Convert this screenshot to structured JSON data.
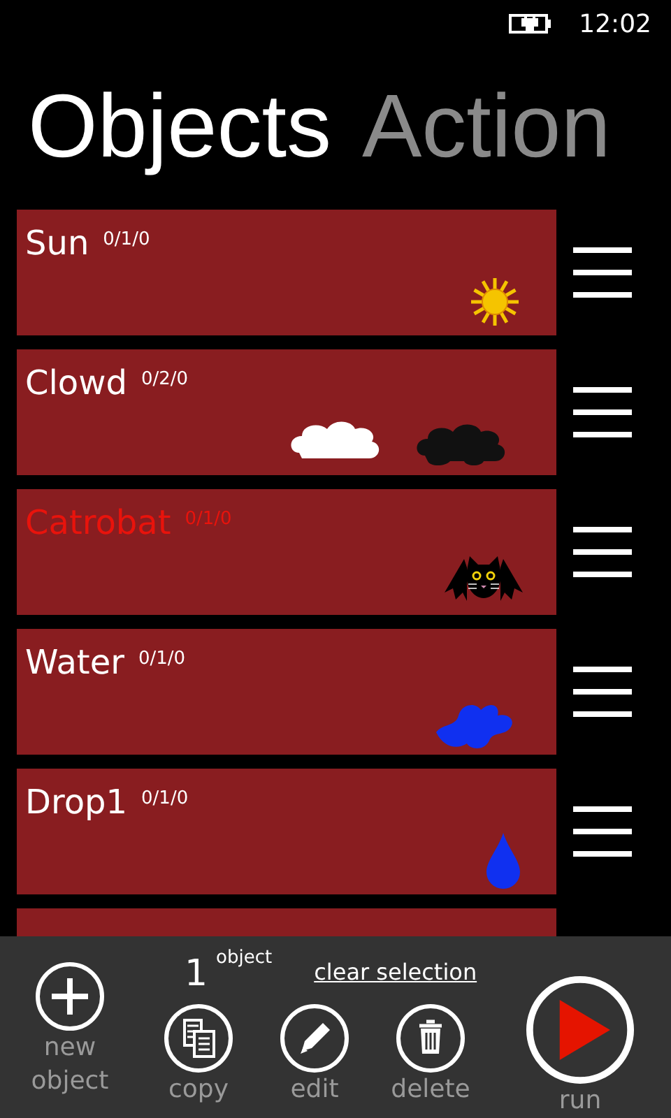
{
  "status_bar": {
    "time": "12:02"
  },
  "pivot": [
    {
      "label": "Objects",
      "selected": true
    },
    {
      "label": "Action",
      "selected": false
    }
  ],
  "objects": [
    {
      "name": "Sun",
      "counts": "0/1/0",
      "kind": "sun",
      "selected": false
    },
    {
      "name": "Clowd",
      "counts": "0/2/0",
      "kind": "clouds",
      "selected": false
    },
    {
      "name": "Catrobat",
      "counts": "0/1/0",
      "kind": "cat",
      "selected": true
    },
    {
      "name": "Water",
      "counts": "0/1/0",
      "kind": "splash",
      "selected": false
    },
    {
      "name": "Drop1",
      "counts": "0/1/0",
      "kind": "drop",
      "selected": false
    },
    {
      "kind": "none"
    }
  ],
  "app_bar": {
    "new_label": "new object",
    "count": "1",
    "count_unit": "object",
    "clear": "clear selection",
    "actions": [
      {
        "kind": "copy",
        "label": "copy"
      },
      {
        "kind": "edit",
        "label": "edit"
      },
      {
        "kind": "delete",
        "label": "delete"
      }
    ],
    "run_label": "run"
  }
}
